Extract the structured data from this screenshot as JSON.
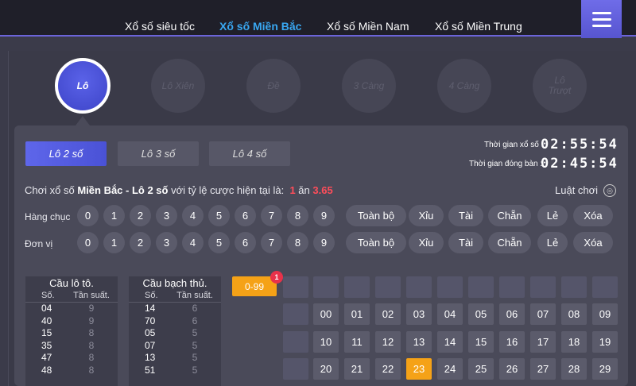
{
  "nav": {
    "items": [
      {
        "label": "Xổ số siêu tốc",
        "active": false
      },
      {
        "label": "Xổ số Miền Bắc",
        "active": true
      },
      {
        "label": "Xổ số Miền Nam",
        "active": false
      },
      {
        "label": "Xổ số Miền Trung",
        "active": false
      }
    ],
    "menu_icon": "hamburger-icon",
    "accent_color": "#39a8f2"
  },
  "game_types": [
    {
      "label": "Lô",
      "active": true
    },
    {
      "label": "Lô Xiên",
      "active": false
    },
    {
      "label": "Đề",
      "active": false
    },
    {
      "label": "3 Càng",
      "active": false
    },
    {
      "label": "4 Càng",
      "active": false
    },
    {
      "label": "Lô Trượt",
      "active": false
    }
  ],
  "sub_tabs": [
    {
      "label": "Lô 2 số",
      "active": true
    },
    {
      "label": "Lô 3 số",
      "active": false
    },
    {
      "label": "Lô 4 số",
      "active": false
    }
  ],
  "timers": {
    "draw_label": "Thời gian xổ số :",
    "draw_value": "02:55:54",
    "close_label": "Thời gian đóng bàn :",
    "close_value": "02:45:54"
  },
  "rate": {
    "prefix": "Chơi xổ số",
    "game": "Miền Bắc - Lô 2 số",
    "middle": "với tỷ lệ cược hiện tại là:",
    "stake": "1",
    "win_word": "ăn",
    "payout": "3.65"
  },
  "rules_label": "Luật chơi",
  "rules_icon": "globe-icon",
  "picker_rows": [
    {
      "label": "Hàng chục"
    },
    {
      "label": "Đơn vị"
    }
  ],
  "digits": [
    "0",
    "1",
    "2",
    "3",
    "4",
    "5",
    "6",
    "7",
    "8",
    "9"
  ],
  "quick_options": [
    "Toàn bộ",
    "Xỉu",
    "Tài",
    "Chẵn",
    "Lẻ",
    "Xóa"
  ],
  "stats": [
    {
      "title": "Cầu lô tô.",
      "col_no": "Số.",
      "col_freq": "Tần suất.",
      "rows": [
        [
          "04",
          "9"
        ],
        [
          "40",
          "9"
        ],
        [
          "15",
          "8"
        ],
        [
          "35",
          "8"
        ],
        [
          "47",
          "8"
        ],
        [
          "48",
          "8"
        ]
      ]
    },
    {
      "title": "Cầu bạch thủ.",
      "col_no": "Số.",
      "col_freq": "Tần suất.",
      "rows": [
        [
          "14",
          "6"
        ],
        [
          "70",
          "6"
        ],
        [
          "05",
          "5"
        ],
        [
          "07",
          "5"
        ],
        [
          "13",
          "5"
        ],
        [
          "51",
          "5"
        ]
      ]
    }
  ],
  "range_button": "0-99",
  "range_badge": "1",
  "number_rows": [
    [
      "00",
      "01",
      "02",
      "03",
      "04",
      "05",
      "06",
      "07",
      "08",
      "09"
    ],
    [
      "10",
      "11",
      "12",
      "13",
      "14",
      "15",
      "16",
      "17",
      "18",
      "19"
    ],
    [
      "20",
      "21",
      "22",
      "23",
      "24",
      "25",
      "26",
      "27",
      "28",
      "29"
    ]
  ],
  "selected_number": "23",
  "selected_color": "#f5a217"
}
